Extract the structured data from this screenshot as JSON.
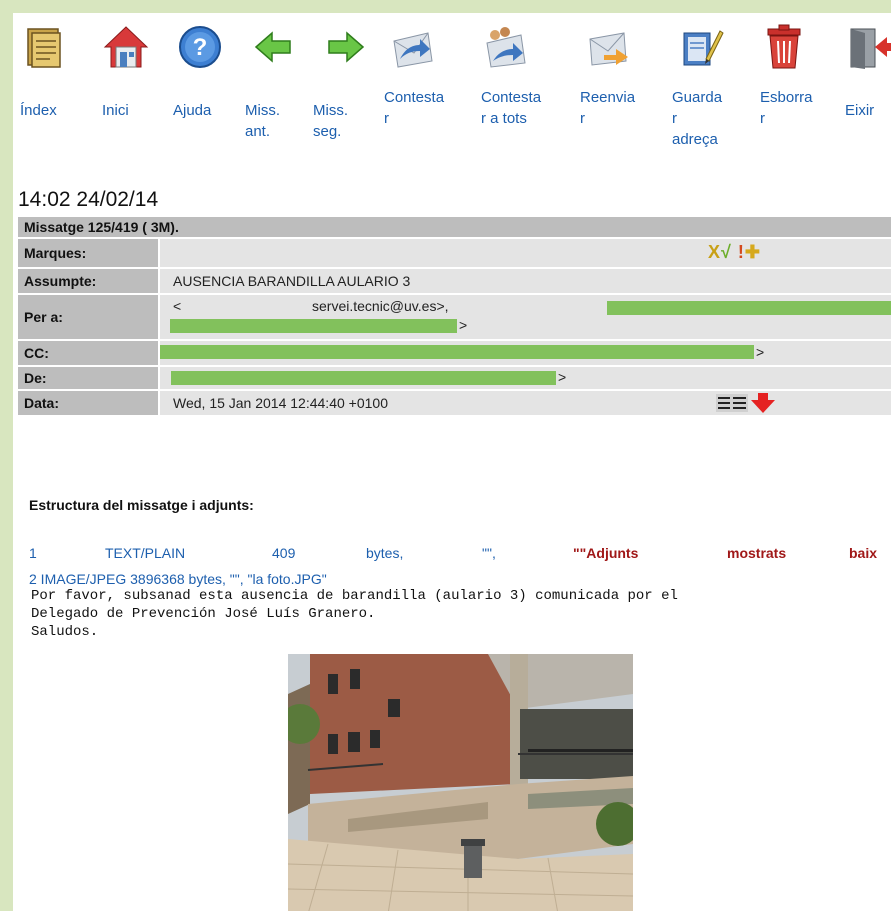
{
  "toolbar": {
    "index": "Índex",
    "home": "Inici",
    "help": "Ajuda",
    "prev": "Miss.\nant.",
    "next": "Miss.\nseg.",
    "reply": "Contesta\nr",
    "reply_all": "Contesta\nr a tots",
    "forward": "Reenvia\nr",
    "save_address": "Guarda\nr\nadreça",
    "delete": "Esborra\nr",
    "exit": "Eixir"
  },
  "time": "14:02 24/02/14",
  "message_header": {
    "title": "Missatge 125/419 ( 3M).",
    "flags_label": "Marques:",
    "subject_label": "Assumpte:",
    "subject": "AUSENCIA BARANDILLA AULARIO 3",
    "to_label": "Per a:",
    "to_prefix": "<",
    "to_email": "servei.tecnic@uv.es>,",
    "to_line2_end": ">",
    "to_line1_end": ">",
    "cc_label": "CC:",
    "cc_end": ">",
    "from_label": "De:",
    "from_end": ">",
    "date_label": "Data:",
    "date": "Wed, 15 Jan 2014 12:44:40 +0100"
  },
  "structure": {
    "heading": "Estructura del missatge i adjunts:",
    "part1": {
      "num": "1",
      "type": "TEXT/PLAIN",
      "size": "409",
      "unit": "bytes,",
      "desc": "\"\",",
      "note1": "\"\"Adjunts",
      "note2": "mostrats",
      "note3": "baix"
    },
    "part2": "2 IMAGE/JPEG 3896368 bytes, \"\", \"la foto.JPG\""
  },
  "body_lines": [
    "Por favor, subsanad esta ausencia de barandilla (aulario 3) comunicada por el",
    "Delegado de Prevención José Luís Granero.",
    "Saludos."
  ],
  "colors": {
    "page_bg": "#d8e6bf",
    "link": "#1d5fae",
    "redaction": "#82c15c",
    "label_bg": "#bdbdbd",
    "value_bg": "#e4e4e4"
  }
}
